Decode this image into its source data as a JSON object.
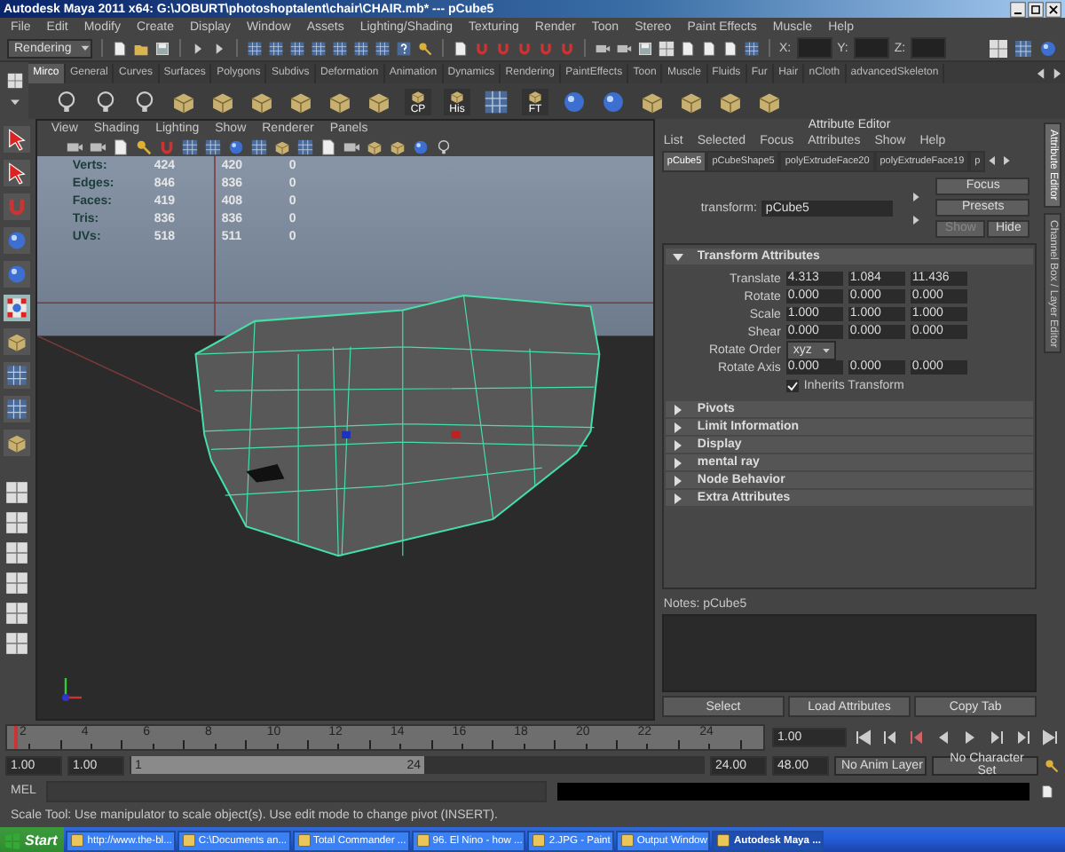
{
  "window": {
    "title": "Autodesk Maya 2011 x64: G:\\JOBURT\\photoshoptalent\\chair\\CHAIR.mb*  ---  pCube5"
  },
  "menu": [
    "File",
    "Edit",
    "Modify",
    "Create",
    "Display",
    "Window",
    "Assets",
    "Lighting/Shading",
    "Texturing",
    "Render",
    "Toon",
    "Stereo",
    "Paint Effects",
    "Muscle",
    "Help"
  ],
  "status_line": {
    "mode": "Rendering",
    "coords": [
      "X:",
      "Y:",
      "Z:"
    ]
  },
  "shelf_tabs": [
    {
      "label": "Mirco",
      "selected": true
    },
    {
      "label": "General",
      "selected": false
    },
    {
      "label": "Curves",
      "selected": false
    },
    {
      "label": "Surfaces",
      "selected": false
    },
    {
      "label": "Polygons",
      "selected": false
    },
    {
      "label": "Subdivs",
      "selected": false
    },
    {
      "label": "Deformation",
      "selected": false
    },
    {
      "label": "Animation",
      "selected": false
    },
    {
      "label": "Dynamics",
      "selected": false
    },
    {
      "label": "Rendering",
      "selected": false
    },
    {
      "label": "PaintEffects",
      "selected": false
    },
    {
      "label": "Toon",
      "selected": false
    },
    {
      "label": "Muscle",
      "selected": false
    },
    {
      "label": "Fluids",
      "selected": false
    },
    {
      "label": "Fur",
      "selected": false
    },
    {
      "label": "Hair",
      "selected": false
    },
    {
      "label": "nCloth",
      "selected": false
    },
    {
      "label": "advancedSkeleton",
      "selected": false
    }
  ],
  "shelf_captions": [
    "CP",
    "His",
    "FT"
  ],
  "viewport": {
    "menu": [
      "View",
      "Shading",
      "Lighting",
      "Show",
      "Renderer",
      "Panels"
    ],
    "hud": [
      {
        "label": "Verts:",
        "values": [
          "424",
          "420",
          "0"
        ]
      },
      {
        "label": "Edges:",
        "values": [
          "846",
          "836",
          "0"
        ]
      },
      {
        "label": "Faces:",
        "values": [
          "419",
          "408",
          "0"
        ]
      },
      {
        "label": "Tris:",
        "values": [
          "836",
          "836",
          "0"
        ]
      },
      {
        "label": "UVs:",
        "values": [
          "518",
          "511",
          "0"
        ]
      }
    ]
  },
  "attribute_editor": {
    "title": "Attribute Editor",
    "menu": [
      "List",
      "Selected",
      "Focus",
      "Attributes",
      "Show",
      "Help"
    ],
    "tabs": [
      {
        "label": "pCube5",
        "selected": true
      },
      {
        "label": "pCubeShape5",
        "selected": false
      },
      {
        "label": "polyExtrudeFace20",
        "selected": false
      },
      {
        "label": "polyExtrudeFace19",
        "selected": false
      },
      {
        "label": "p",
        "selected": false
      }
    ],
    "node_label": "transform:",
    "node_value": "pCube5",
    "buttons": [
      "Focus",
      "Presets"
    ],
    "show": "Show",
    "hide": "Hide",
    "sections": [
      {
        "title": "Transform Attributes",
        "expanded": true,
        "rows": [
          {
            "kind": "vector",
            "label": "Translate",
            "values": [
              "4.313",
              "1.084",
              "11.436"
            ]
          },
          {
            "kind": "vector",
            "label": "Rotate",
            "values": [
              "0.000",
              "0.000",
              "0.000"
            ]
          },
          {
            "kind": "vector",
            "label": "Scale",
            "values": [
              "1.000",
              "1.000",
              "1.000"
            ]
          },
          {
            "kind": "vector",
            "label": "Shear",
            "values": [
              "0.000",
              "0.000",
              "0.000"
            ]
          },
          {
            "kind": "dropdown",
            "label": "Rotate Order",
            "value": "xyz"
          },
          {
            "kind": "vector",
            "label": "Rotate Axis",
            "values": [
              "0.000",
              "0.000",
              "0.000"
            ]
          },
          {
            "kind": "checkbox",
            "label": "Inherits Transform",
            "checked": true
          }
        ]
      },
      {
        "title": "Pivots",
        "expanded": false
      },
      {
        "title": "Limit Information",
        "expanded": false
      },
      {
        "title": "Display",
        "expanded": false
      },
      {
        "title": "mental ray",
        "expanded": false
      },
      {
        "title": "Node Behavior",
        "expanded": false
      },
      {
        "title": "Extra Attributes",
        "expanded": false
      }
    ],
    "notes_label": "Notes: pCube5",
    "bottom_buttons": [
      "Select",
      "Load Attributes",
      "Copy Tab"
    ]
  },
  "side_tabs": [
    {
      "label": "Attribute Editor",
      "selected": true
    },
    {
      "label": "Channel Box / Layer Editor",
      "selected": false
    }
  ],
  "time_slider": {
    "frame_labels": [
      "2",
      "4",
      "6",
      "8",
      "10",
      "12",
      "14",
      "16",
      "18",
      "20",
      "22",
      "24"
    ],
    "current": "1.00",
    "level": 0
  },
  "range_slider": {
    "start": "1.00",
    "playback_start": "1.00",
    "range_start": "1",
    "range_end": "24",
    "level": 0.5,
    "playback_end": "24.00",
    "end": "48.00",
    "anim_layer": "No Anim Layer",
    "character_set": "No Character Set"
  },
  "command_line": {
    "label": "MEL"
  },
  "help_line": "Scale Tool: Use manipulator to scale object(s). Use edit mode to change pivot (INSERT).",
  "taskbar": {
    "start": "Start",
    "items": [
      {
        "label": "http://www.the-bl...",
        "selected": false
      },
      {
        "label": "C:\\Documents an...",
        "selected": false
      },
      {
        "label": "Total Commander ...",
        "selected": false
      },
      {
        "label": "96. El Nino - how ...",
        "selected": false
      },
      {
        "label": "2.JPG - Paint",
        "selected": false
      },
      {
        "label": "Output Window",
        "selected": false
      },
      {
        "label": "Autodesk Maya ...",
        "selected": true
      }
    ]
  }
}
